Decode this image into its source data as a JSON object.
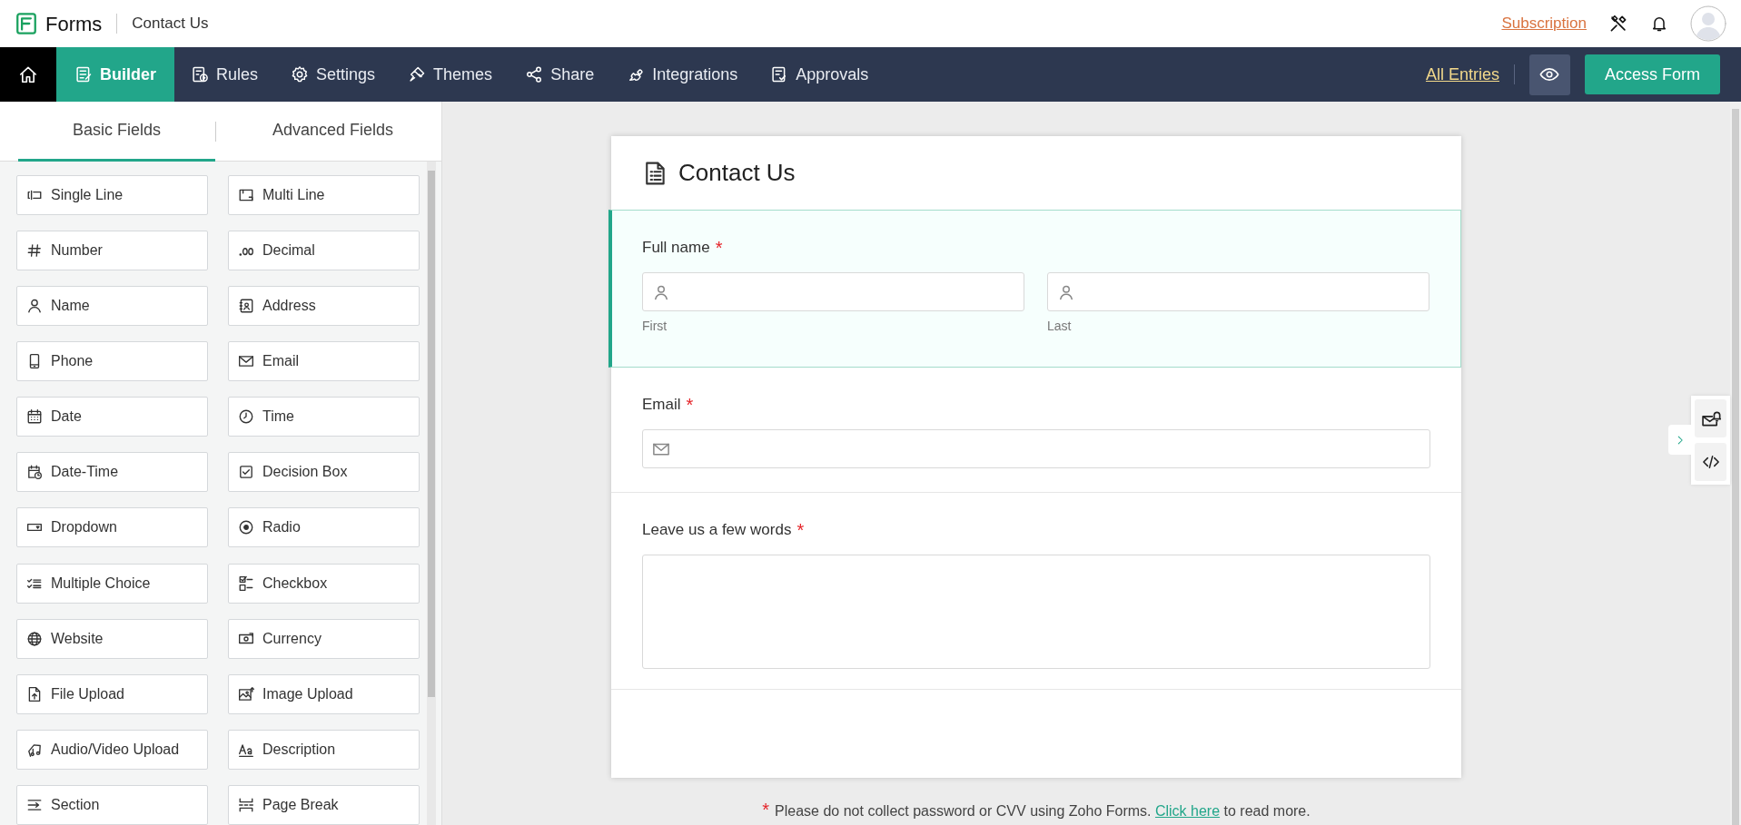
{
  "app": {
    "name": "Forms",
    "form_name": "Contact Us",
    "subscription_link": "Subscription"
  },
  "nav": {
    "tabs": [
      {
        "label": "Builder",
        "selected": true
      },
      {
        "label": "Rules",
        "selected": false
      },
      {
        "label": "Settings",
        "selected": false
      },
      {
        "label": "Themes",
        "selected": false
      },
      {
        "label": "Share",
        "selected": false
      },
      {
        "label": "Integrations",
        "selected": false
      },
      {
        "label": "Approvals",
        "selected": false
      }
    ],
    "all_entries_link": "All Entries",
    "access_button": "Access Form"
  },
  "field_panel": {
    "tabs": [
      {
        "label": "Basic Fields",
        "selected": true
      },
      {
        "label": "Advanced Fields",
        "selected": false
      }
    ],
    "fields": [
      "Single Line",
      "Multi Line",
      "Number",
      "Decimal",
      "Name",
      "Address",
      "Phone",
      "Email",
      "Date",
      "Time",
      "Date-Time",
      "Decision Box",
      "Dropdown",
      "Radio",
      "Multiple Choice",
      "Checkbox",
      "Website",
      "Currency",
      "File Upload",
      "Image Upload",
      "Audio/Video Upload",
      "Description",
      "Section",
      "Page Break"
    ]
  },
  "form": {
    "title": "Contact Us",
    "sections": [
      {
        "kind": "name",
        "label": "Full name",
        "required_mark": "*",
        "selected": true,
        "sublabels": [
          "First",
          "Last"
        ]
      },
      {
        "kind": "email",
        "label": "Email",
        "required_mark": "*",
        "selected": false
      },
      {
        "kind": "textarea",
        "label": "Leave us a few words",
        "required_mark": "*",
        "selected": false
      }
    ]
  },
  "notice": {
    "mark": "*",
    "text": "Please do not collect password or CVV using Zoho Forms.",
    "link": "Click here",
    "after": "to read more."
  }
}
